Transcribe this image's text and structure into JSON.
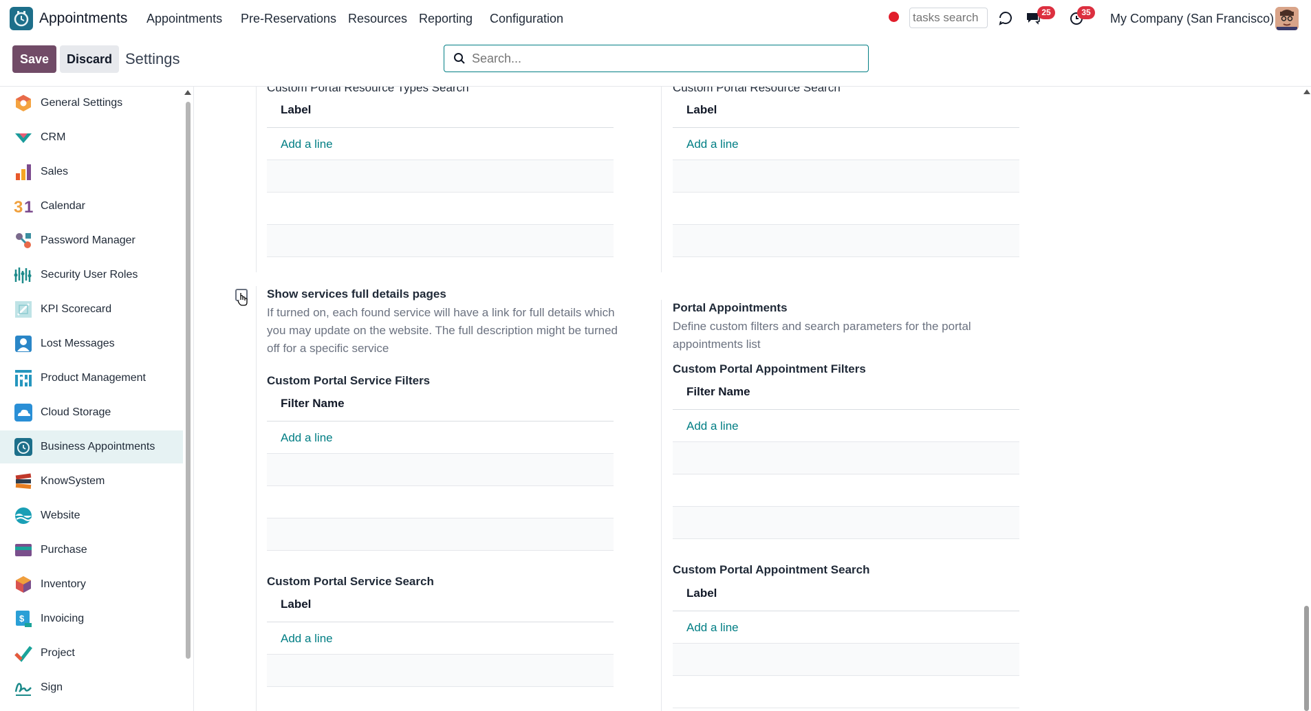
{
  "topbar": {
    "app_name": "Appointments",
    "menus": [
      "Appointments",
      "Pre-Reservations",
      "Resources",
      "Reporting",
      "Configuration"
    ],
    "tasks_search_placeholder": "tasks search",
    "messages_badge": "25",
    "activities_badge": "35",
    "company": "My Company (San Francisco)"
  },
  "control": {
    "save_label": "Save",
    "discard_label": "Discard",
    "title": "Settings",
    "search_placeholder": "Search..."
  },
  "sidebar": {
    "items": [
      {
        "label": "General Settings",
        "icon": "general-settings-icon",
        "color": "#f4a340"
      },
      {
        "label": "CRM",
        "icon": "crm-icon",
        "color": "#1a9b9b"
      },
      {
        "label": "Sales",
        "icon": "sales-icon",
        "color": "#f08b3c"
      },
      {
        "label": "Calendar",
        "icon": "calendar-icon",
        "color": "#e8a13a"
      },
      {
        "label": "Password Manager",
        "icon": "password-manager-icon",
        "color": "#7a6a8c"
      },
      {
        "label": "Security User Roles",
        "icon": "security-user-roles-icon",
        "color": "#1c8a8a"
      },
      {
        "label": "KPI Scorecard",
        "icon": "kpi-scorecard-icon",
        "color": "#8ccbd1"
      },
      {
        "label": "Lost Messages",
        "icon": "lost-messages-icon",
        "color": "#2a86c7"
      },
      {
        "label": "Product Management",
        "icon": "product-management-icon",
        "color": "#2596be"
      },
      {
        "label": "Cloud Storage",
        "icon": "cloud-storage-icon",
        "color": "#2a8fd6"
      },
      {
        "label": "Business Appointments",
        "icon": "business-appointments-icon",
        "color": "#1d6f8a"
      },
      {
        "label": "KnowSystem",
        "icon": "knowsystem-icon",
        "color": "#c0392b"
      },
      {
        "label": "Website",
        "icon": "website-icon",
        "color": "#1a9fb5"
      },
      {
        "label": "Purchase",
        "icon": "purchase-icon",
        "color": "#7a4f8c"
      },
      {
        "label": "Inventory",
        "icon": "inventory-icon",
        "color": "#d9534f"
      },
      {
        "label": "Invoicing",
        "icon": "invoicing-icon",
        "color": "#2a9fd6"
      },
      {
        "label": "Project",
        "icon": "project-icon",
        "color": "#1aa39a"
      },
      {
        "label": "Sign",
        "icon": "sign-icon",
        "color": "#1c8a8a"
      }
    ],
    "active": "Business Appointments"
  },
  "content": {
    "top_left": {
      "title": "Custom Portal Resource Types Search",
      "header": "Label",
      "add": "Add a line"
    },
    "top_right": {
      "title": "Custom Portal Resource Search",
      "header": "Label",
      "add": "Add a line"
    },
    "services": {
      "title": "Show services full details pages",
      "description": "If turned on, each found service will have a link for full details which you may update on the website. The full description might be turned off for a specific service",
      "filters": {
        "title": "Custom Portal Service Filters",
        "header": "Filter Name",
        "add": "Add a line"
      },
      "search": {
        "title": "Custom Portal Service Search",
        "header": "Label",
        "add": "Add a line"
      }
    },
    "appointments": {
      "title": "Portal Appointments",
      "description": "Define custom filters and search parameters for the portal appointments list",
      "filters": {
        "title": "Custom Portal Appointment Filters",
        "header": "Filter Name",
        "add": "Add a line"
      },
      "search": {
        "title": "Custom Portal Appointment Search",
        "header": "Label",
        "add": "Add a line"
      }
    }
  }
}
